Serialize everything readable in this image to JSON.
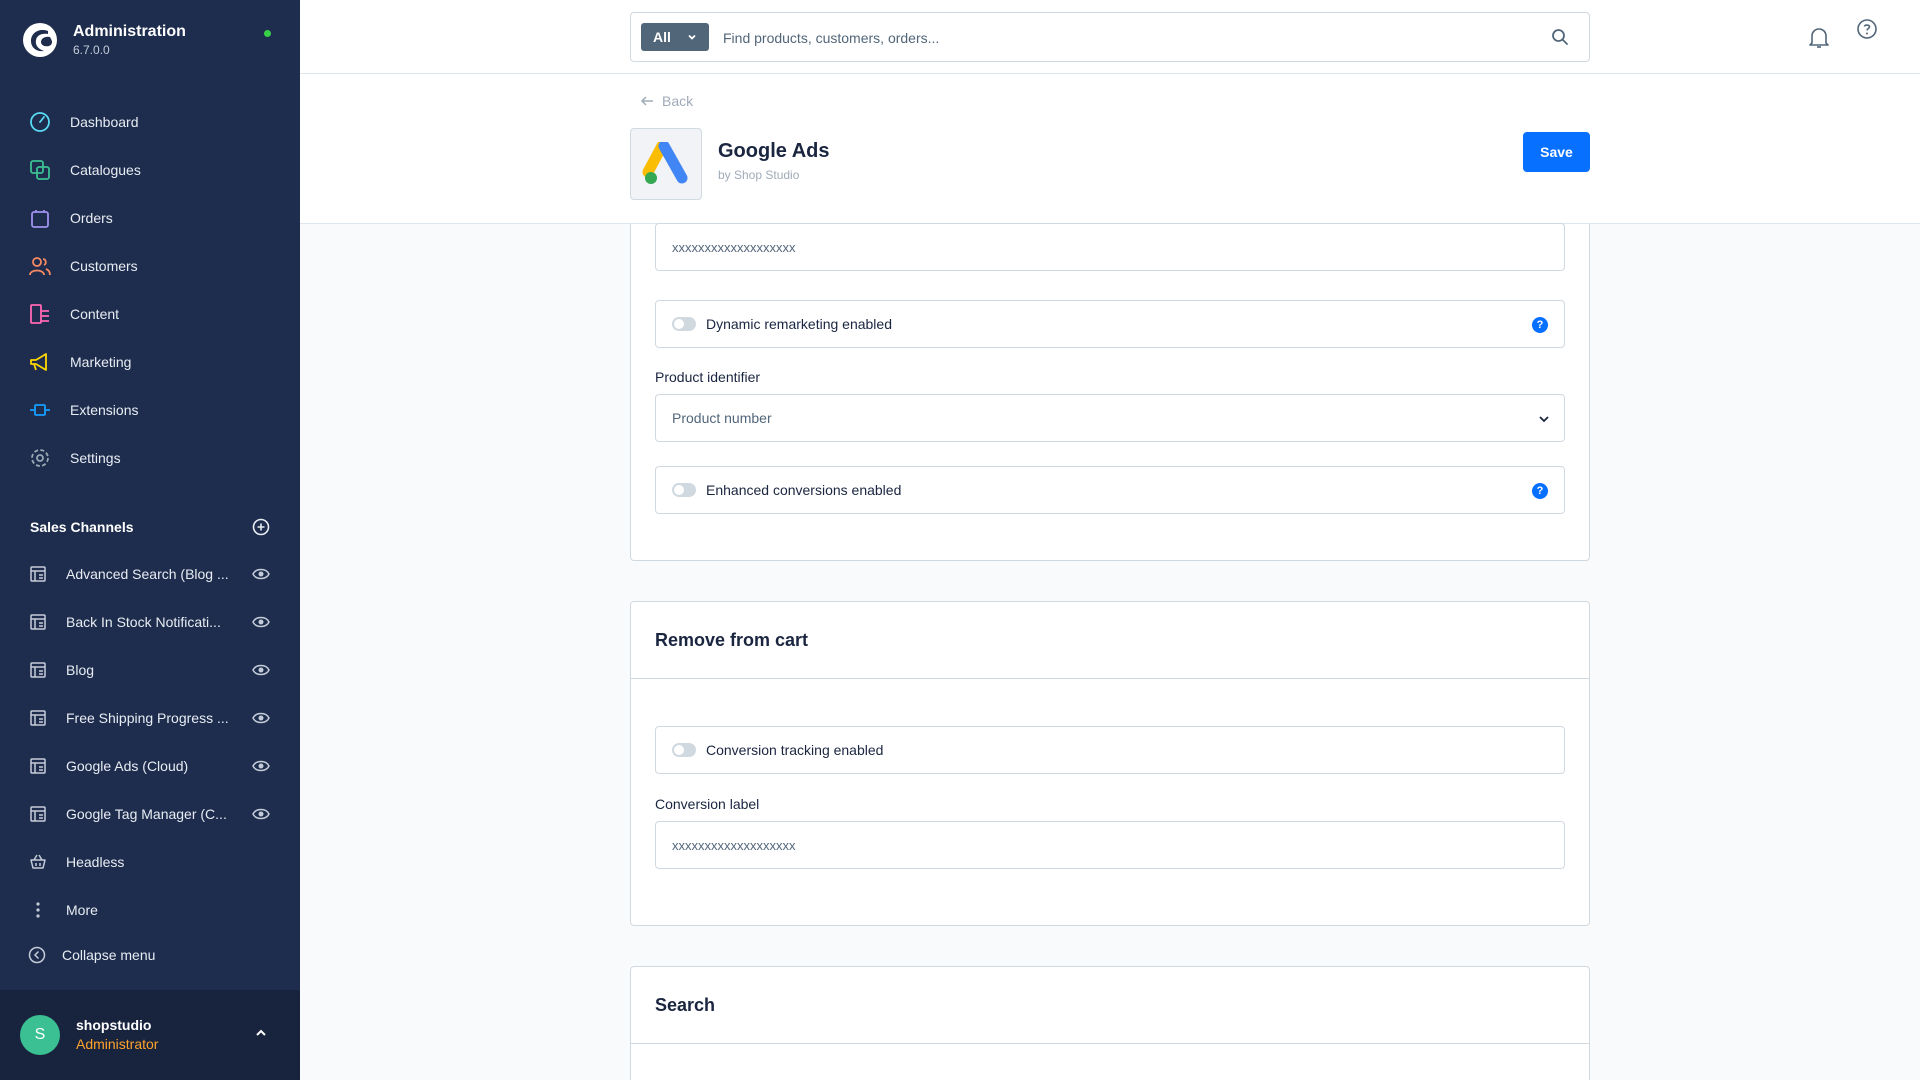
{
  "brand": {
    "title": "Administration",
    "version": "6.7.0.0"
  },
  "nav": [
    {
      "label": "Dashboard",
      "icon": "dashboard-icon",
      "color": "#57d9f2"
    },
    {
      "label": "Catalogues",
      "icon": "catalogues-icon",
      "color": "#3bc093"
    },
    {
      "label": "Orders",
      "icon": "orders-icon",
      "color": "#a092f0"
    },
    {
      "label": "Customers",
      "icon": "customers-icon",
      "color": "#f88962"
    },
    {
      "label": "Content",
      "icon": "content-icon",
      "color": "#ff68b4"
    },
    {
      "label": "Marketing",
      "icon": "marketing-icon",
      "color": "#ffd700"
    },
    {
      "label": "Extensions",
      "icon": "extensions-icon",
      "color": "#189eff"
    },
    {
      "label": "Settings",
      "icon": "settings-icon",
      "color": "#9aa8b5"
    }
  ],
  "sales_channels": {
    "title": "Sales Channels",
    "items": [
      {
        "label": "Advanced Search (Blog ..."
      },
      {
        "label": "Back In Stock Notificati..."
      },
      {
        "label": "Blog"
      },
      {
        "label": "Free Shipping Progress ..."
      },
      {
        "label": "Google Ads (Cloud)"
      },
      {
        "label": "Google Tag Manager (C..."
      },
      {
        "label": "Headless"
      },
      {
        "label": "More"
      }
    ],
    "collapse_label": "Collapse menu"
  },
  "user": {
    "initial": "S",
    "name": "shopstudio",
    "role": "Administrator"
  },
  "topbar": {
    "search_type": "All",
    "search_placeholder": "Find products, customers, orders..."
  },
  "header": {
    "back_label": "Back",
    "app_title": "Google Ads",
    "app_by": "by Shop Studio",
    "save_label": "Save"
  },
  "top_card": {
    "id_value": "xxxxxxxxxxxxxxxxxxx",
    "dynamic_remarketing_label": "Dynamic remarketing enabled",
    "product_identifier_label": "Product identifier",
    "product_identifier_value": "Product number",
    "enhanced_conversions_label": "Enhanced conversions enabled",
    "help_glyph": "?"
  },
  "remove_from_cart": {
    "title": "Remove from cart",
    "conversion_tracking_label": "Conversion tracking enabled",
    "conversion_label_label": "Conversion label",
    "conversion_label_value": "xxxxxxxxxxxxxxxxxxx"
  },
  "search_card": {
    "title": "Search"
  }
}
